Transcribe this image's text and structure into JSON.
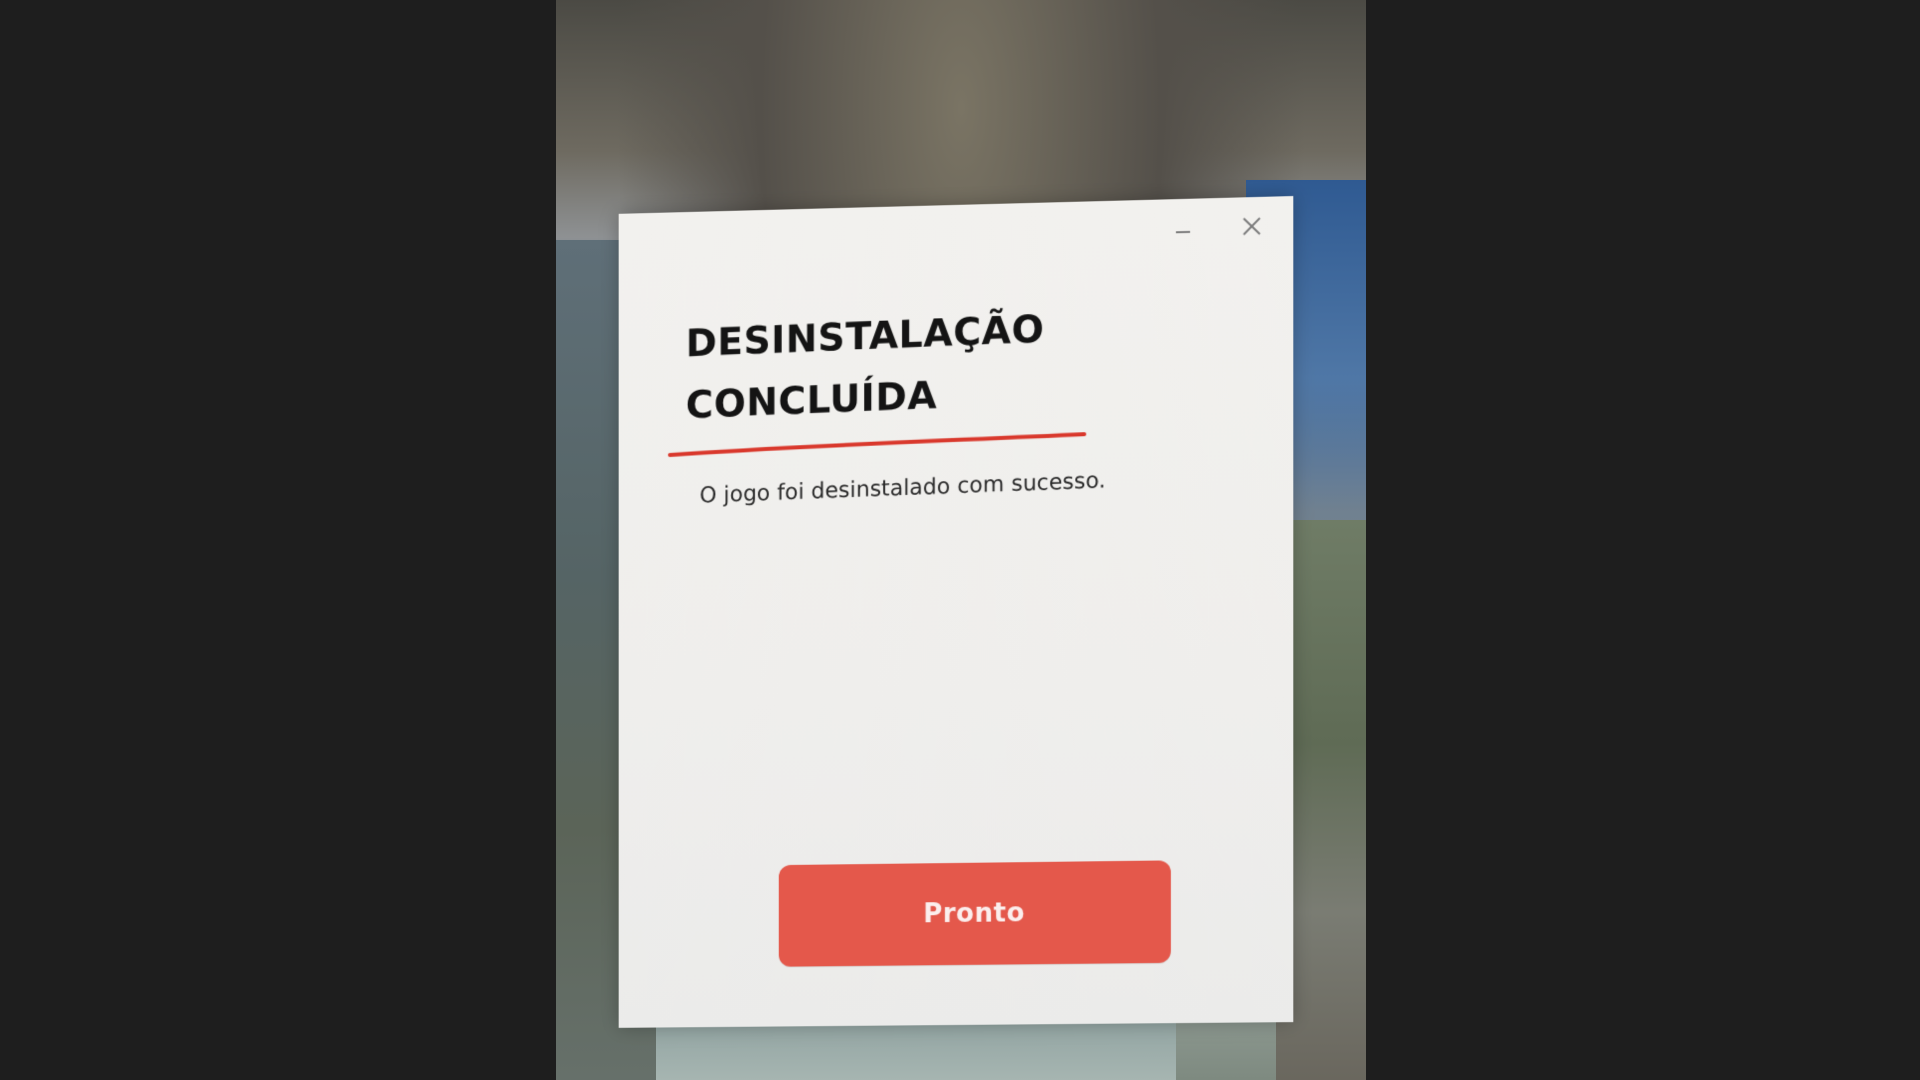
{
  "dialog": {
    "title_line1": "DESINSTALAÇÃO",
    "title_line2": "CONCLUÍDA",
    "message": "O jogo foi desinstalado com sucesso.",
    "primary_button_label": "Pronto"
  },
  "window_controls": {
    "minimize_icon": "minimize-icon",
    "close_icon": "close-icon"
  },
  "colors": {
    "accent": "#e4584b",
    "accent_line": "#d9382c",
    "title_text": "#141414",
    "dialog_bg": "#f0efed"
  }
}
